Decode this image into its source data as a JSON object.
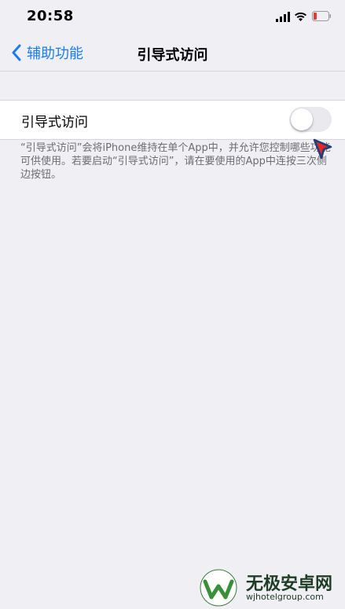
{
  "status_bar": {
    "time": "20:58",
    "icons": [
      "cellular-signal-icon",
      "wifi-icon",
      "battery-low-icon"
    ],
    "battery_color": "#e53935"
  },
  "nav": {
    "back_label": "辅助功能",
    "title": "引导式访问",
    "accent_color": "#1a7cf5"
  },
  "setting": {
    "label": "引导式访问",
    "toggle_on": false
  },
  "footer": {
    "description": "“引导式访问”会将iPhone维持在单个App中，并允许您控制哪些功能可供使用。若要启动“引导式访问”，请在要使用的App中连按三次侧边按钮。"
  },
  "watermark": {
    "title": "无极安卓网",
    "url": "wjhotelgroup.com"
  }
}
